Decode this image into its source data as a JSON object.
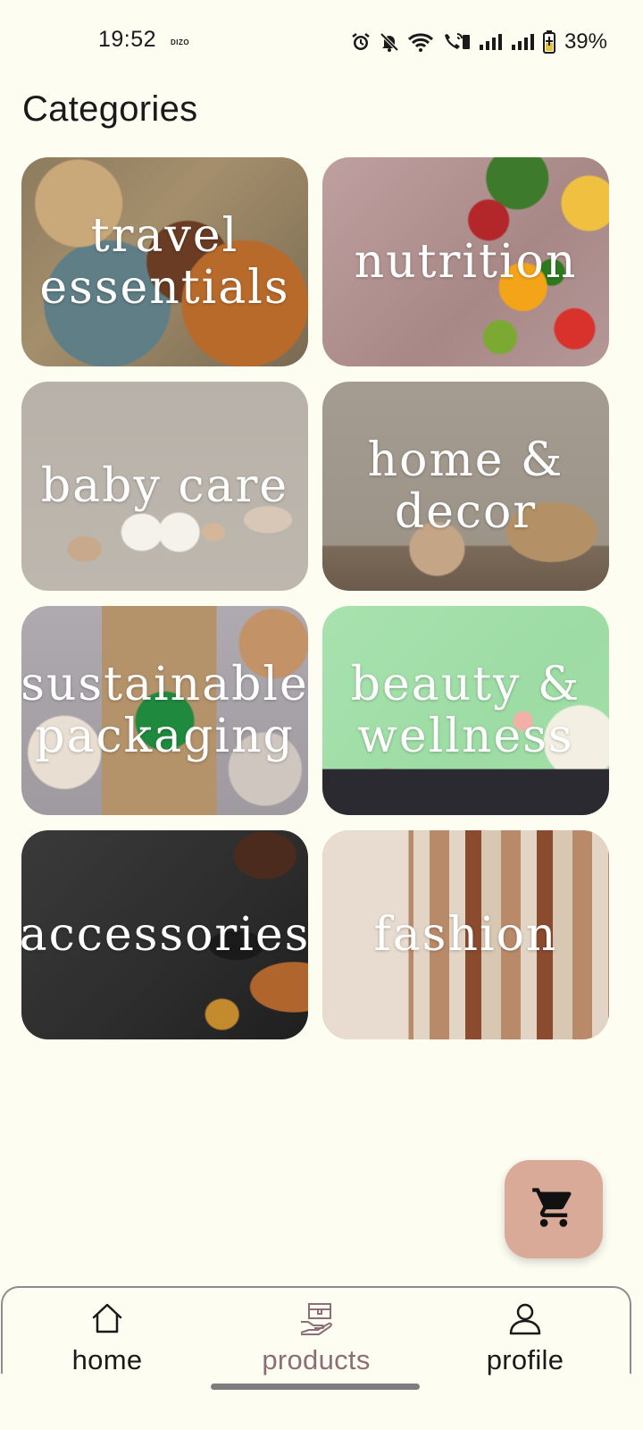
{
  "status_bar": {
    "time": "19:52",
    "carrier": "DIZO",
    "battery": "39%",
    "icons": [
      "alarm-icon",
      "mute-icon",
      "wifi-icon",
      "volte-icon",
      "signal-icon",
      "signal-icon",
      "battery-charging-icon"
    ]
  },
  "page": {
    "title": "Categories"
  },
  "categories": [
    {
      "label": "travel\nessentials"
    },
    {
      "label": "nutrition"
    },
    {
      "label": "baby care"
    },
    {
      "label": "home &\ndecor"
    },
    {
      "label": "sustainable\npackaging"
    },
    {
      "label": "beauty &\nwellness"
    },
    {
      "label": "accessories"
    },
    {
      "label": "fashion"
    }
  ],
  "fab": {
    "icon": "cart-icon",
    "color": "#d8aa97"
  },
  "bottom_nav": {
    "items": [
      {
        "label": "home",
        "icon": "home-icon"
      },
      {
        "label": "products",
        "icon": "products-icon",
        "active": true
      },
      {
        "label": "profile",
        "icon": "profile-icon"
      }
    ],
    "active_color": "#8d6e78"
  }
}
